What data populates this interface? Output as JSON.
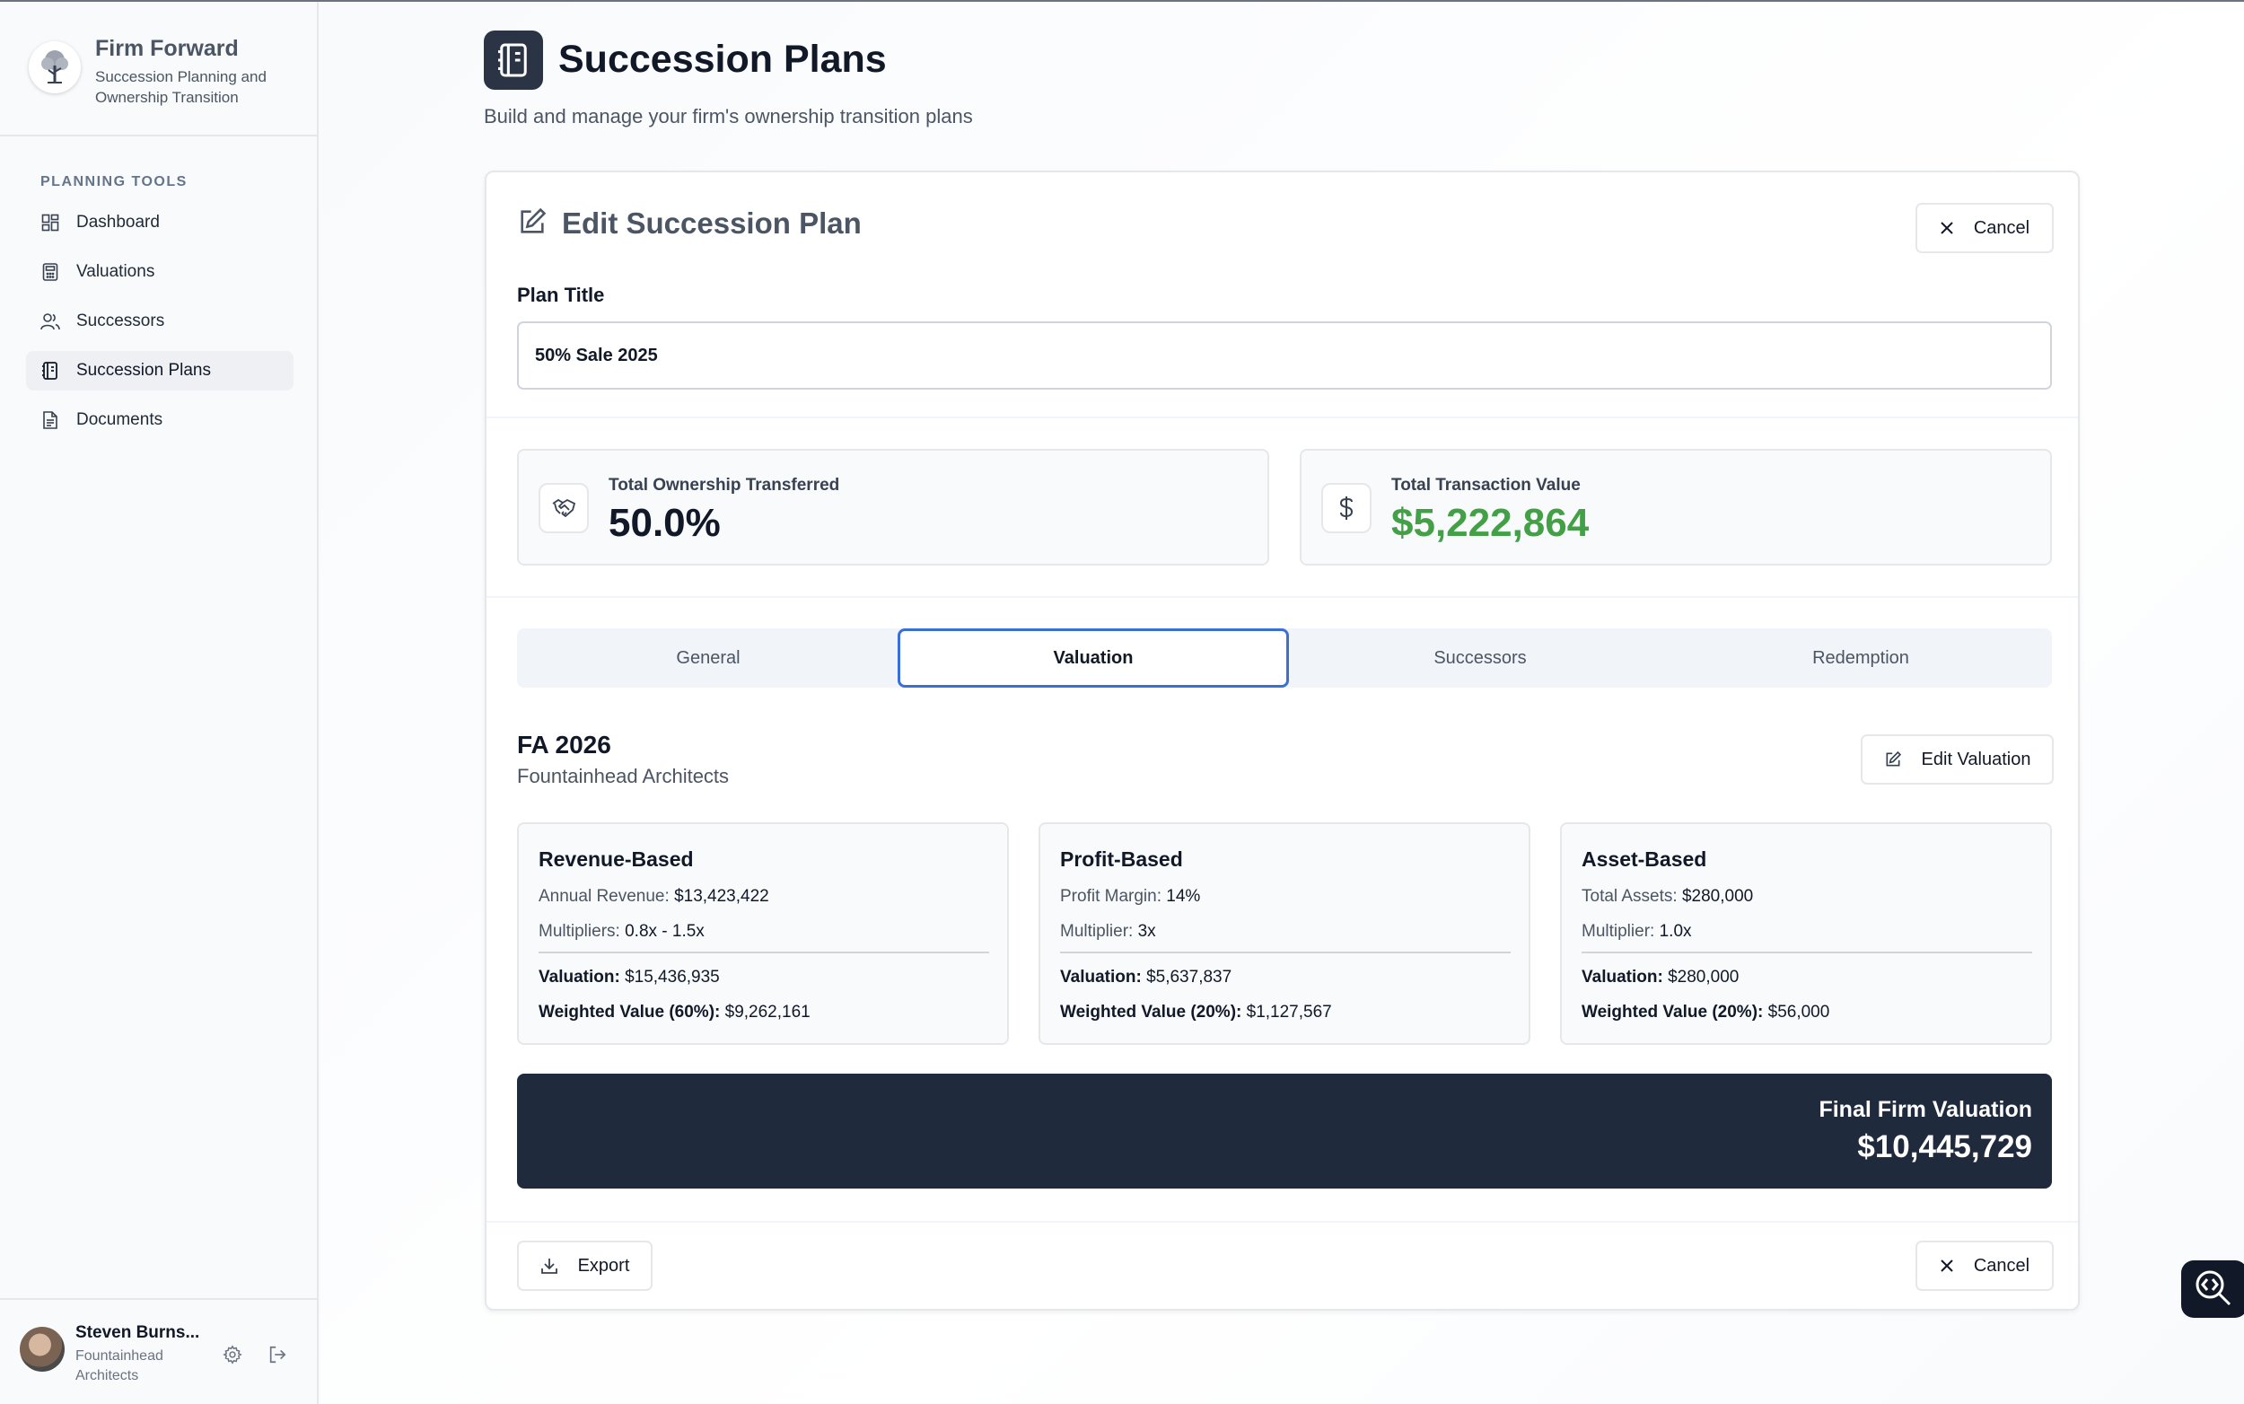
{
  "brand": {
    "title": "Firm Forward",
    "subtitle": "Succession Planning and Ownership Transition",
    "logo_icon": "tree-logo-icon"
  },
  "sidebar": {
    "heading": "PLANNING TOOLS",
    "items": [
      {
        "label": "Dashboard",
        "icon": "dashboard-grid-icon"
      },
      {
        "label": "Valuations",
        "icon": "calculator-icon"
      },
      {
        "label": "Successors",
        "icon": "users-icon"
      },
      {
        "label": "Succession Plans",
        "icon": "notebook-icon",
        "active": true
      },
      {
        "label": "Documents",
        "icon": "document-icon"
      }
    ]
  },
  "user": {
    "name": "Steven Burns...",
    "org": "Fountainhead Architects",
    "actions": [
      "settings-gear-icon",
      "logout-icon"
    ]
  },
  "page": {
    "title": "Succession Plans",
    "subtitle": "Build and manage your firm's ownership transition plans"
  },
  "card": {
    "title": "Edit Succession Plan",
    "cancel_label": "Cancel",
    "plan_title_label": "Plan Title",
    "plan_title_value": "50% Sale 2025"
  },
  "stats": [
    {
      "label": "Total Ownership Transferred",
      "value": "50.0%",
      "icon": "handshake-icon"
    },
    {
      "label": "Total Transaction Value",
      "value": "$5,222,864",
      "icon": "dollar-icon",
      "color": "#43a047"
    }
  ],
  "tabs": [
    "General",
    "Valuation",
    "Successors",
    "Redemption"
  ],
  "active_tab": "Valuation",
  "valuation": {
    "name": "FA 2026",
    "org": "Fountainhead Architects",
    "edit_label": "Edit Valuation",
    "methods": [
      {
        "title": "Revenue-Based",
        "line1_label": "Annual Revenue:",
        "line1_value": "$13,423,422",
        "line2_label": "Multipliers:",
        "line2_value": "0.8x - 1.5x",
        "valuation_label": "Valuation:",
        "valuation_value": "$15,436,935",
        "weighted_label": "Weighted Value (60%):",
        "weighted_value": "$9,262,161"
      },
      {
        "title": "Profit-Based",
        "line1_label": "Profit Margin:",
        "line1_value": "14%",
        "line2_label": "Multiplier:",
        "line2_value": "3x",
        "valuation_label": "Valuation:",
        "valuation_value": "$5,637,837",
        "weighted_label": "Weighted Value (20%):",
        "weighted_value": "$1,127,567"
      },
      {
        "title": "Asset-Based",
        "line1_label": "Total Assets:",
        "line1_value": "$280,000",
        "line2_label": "Multiplier:",
        "line2_value": "1.0x",
        "valuation_label": "Valuation:",
        "valuation_value": "$280,000",
        "weighted_label": "Weighted Value (20%):",
        "weighted_value": "$56,000"
      }
    ],
    "final_label": "Final Firm Valuation",
    "final_value": "$10,445,729"
  },
  "footer": {
    "export_label": "Export",
    "cancel_label": "Cancel"
  },
  "colors": {
    "accent_tab_border": "#3b6fd8",
    "final_bg": "#1f2a3c",
    "positive_green": "#43a047"
  }
}
